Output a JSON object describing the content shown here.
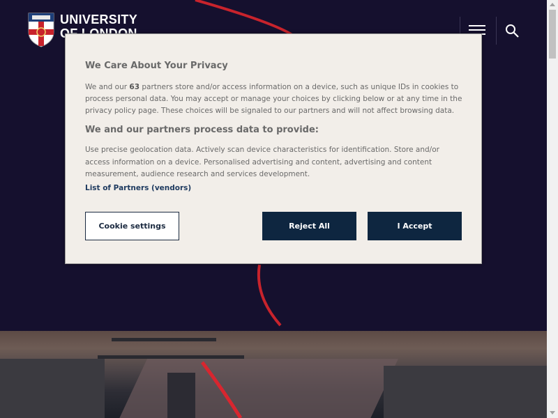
{
  "header": {
    "logo_line1": "UNIVERSITY",
    "logo_line2": "OF LONDON",
    "menu_icon": "hamburger-menu-icon",
    "search_icon": "search-icon"
  },
  "cookie_dialog": {
    "title": "We Care About Your Privacy",
    "intro_prefix": "We and our ",
    "partner_count": "63",
    "intro_suffix": " partners store and/or access information on a device, such as unique IDs in cookies to process personal data. You may accept or manage your choices by clicking below or at any time in the privacy policy page. These choices will be signaled to our partners and will not affect browsing data.",
    "purposes_title": "We and our partners process data to provide:",
    "purposes_text": "Use precise geolocation data. Actively scan device characteristics for identification. Store and/or access information on a device. Personalised advertising and content, advertising and content measurement, audience research and services development.",
    "partners_link": "List of Partners (vendors)",
    "settings_button": "Cookie settings",
    "reject_button": "Reject All",
    "accept_button": "I Accept"
  },
  "colors": {
    "hero_bg": "#15102e",
    "accent_red": "#c8232c",
    "dialog_bg": "#f2eee9",
    "button_dark": "#0e2640"
  }
}
